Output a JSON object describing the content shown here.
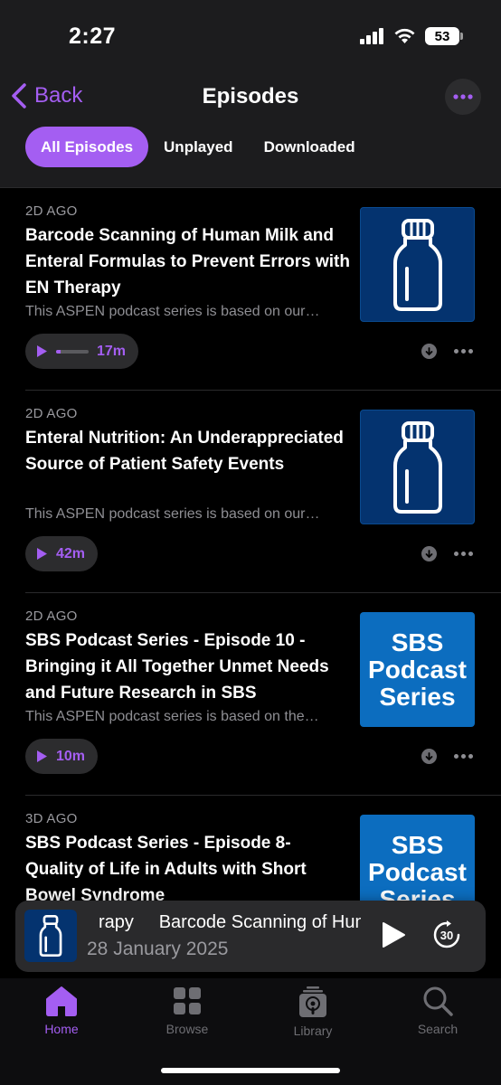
{
  "status_bar": {
    "time": "2:27",
    "battery": "53"
  },
  "nav": {
    "back_label": "Back",
    "title": "Episodes"
  },
  "filters": [
    {
      "label": "All Episodes",
      "active": true
    },
    {
      "label": "Unplayed",
      "active": false
    },
    {
      "label": "Downloaded",
      "active": false
    }
  ],
  "episodes": [
    {
      "date": "2D AGO",
      "title": "Barcode Scanning of Human Milk and Enteral Formulas to Prevent Errors with EN Therapy",
      "description": "This ASPEN podcast series is based on our…",
      "duration": "17m",
      "progress": 0.15,
      "artwork": "bottle"
    },
    {
      "date": "2D AGO",
      "title": "Enteral Nutrition: An Underappreciated Source of Patient Safety Events",
      "description": "This ASPEN podcast series is based on our…",
      "duration": "42m",
      "artwork": "bottle"
    },
    {
      "date": "2D AGO",
      "title": "SBS Podcast Series - Episode 10 - Bringing it All Together Unmet Needs and Future Research in SBS",
      "description": "This ASPEN podcast series is based on the…",
      "duration": "10m",
      "artwork": "sbs",
      "artwork_text": [
        "SBS",
        "Podcast",
        "Series"
      ]
    },
    {
      "date": "3D AGO",
      "title": "SBS Podcast Series - Episode 8- Quality of Life in Adults with Short Bowel Syndrome",
      "artwork": "sbs",
      "artwork_text": [
        "SBS",
        "Podcast",
        "Series"
      ]
    }
  ],
  "mini_player": {
    "title": "rapy     Barcode Scanning of Human Milk",
    "subtitle": "28 January 2025",
    "skip_seconds": "30"
  },
  "tabs": [
    {
      "label": "Home",
      "icon": "house-icon",
      "active": true
    },
    {
      "label": "Browse",
      "icon": "grid-icon",
      "active": false
    },
    {
      "label": "Library",
      "icon": "library-icon",
      "active": false
    },
    {
      "label": "Search",
      "icon": "search-icon",
      "active": false
    }
  ],
  "colors": {
    "accent": "#a45ef2",
    "background": "#000000",
    "bar": "#1c1c1e",
    "bottle_art": "#04336f",
    "sbs_art": "#0c6dbf"
  }
}
